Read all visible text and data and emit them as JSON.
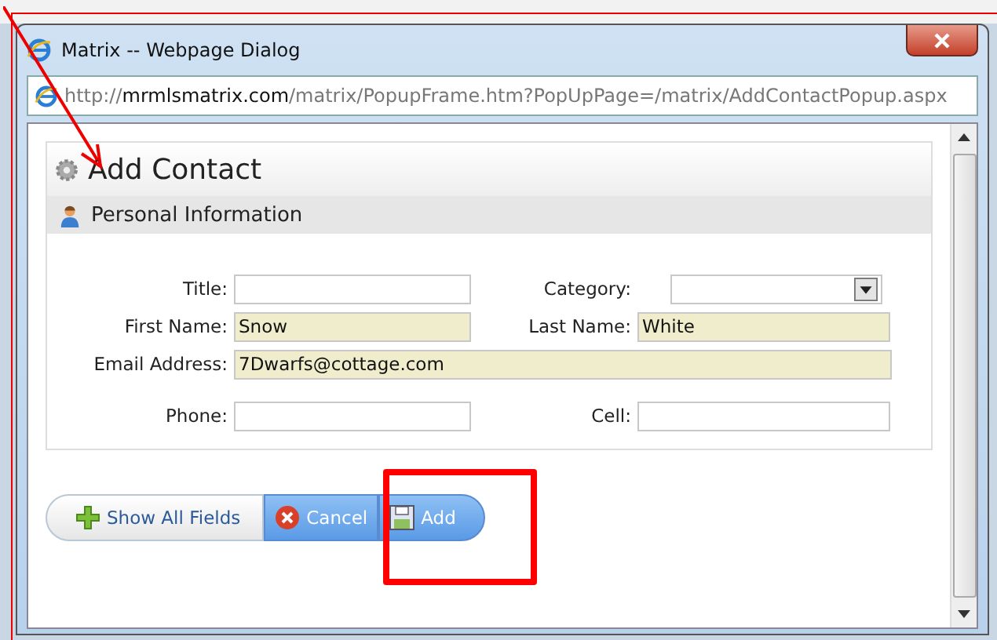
{
  "window": {
    "title": "Matrix -- Webpage Dialog",
    "url": "http://**mrmlsmatrix.com**/matrix/PopupFrame.htm?PopUpPage=/matrix/AddContactPopup.aspx"
  },
  "heading": "Add Contact",
  "section": "Personal Information",
  "form_rows": [
    [
      {
        "label": "Title:",
        "kind": "text",
        "autofilled": false
      },
      {
        "label": "Category:",
        "kind": "select"
      }
    ],
    [
      {
        "label": "First Name:",
        "kind": "text",
        "value": "Snow",
        "autofilled": true
      },
      {
        "label": "Last Name:",
        "kind": "text",
        "value": "White",
        "autofilled": true
      }
    ],
    [
      {
        "label": "Email Address:",
        "kind": "text",
        "value": "7Dwarfs@cottage.com",
        "autofilled": true
      }
    ],
    [
      {
        "label": "Phone:",
        "kind": "text",
        "autofilled": false
      },
      {
        "label": "Cell:",
        "kind": "text",
        "autofilled": false
      }
    ]
  ],
  "buttons": [
    {
      "label": "Show All Fields",
      "kind": "plus"
    },
    {
      "label": "Cancel",
      "kind": "cancel"
    },
    {
      "label": "Add",
      "kind": "save"
    }
  ]
}
